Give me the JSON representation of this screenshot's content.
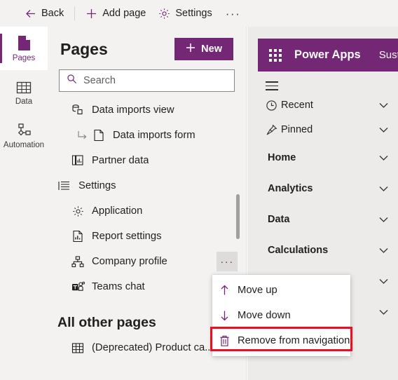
{
  "commandbar": {
    "back_label": "Back",
    "add_page_label": "Add page",
    "settings_label": "Settings",
    "overflow_label": "···"
  },
  "rail": {
    "items": [
      {
        "label": "Pages",
        "icon": "page-icon",
        "active": true
      },
      {
        "label": "Data",
        "icon": "table-icon",
        "active": false
      },
      {
        "label": "Automation",
        "icon": "automation-icon",
        "active": false
      }
    ]
  },
  "pages_panel": {
    "title": "Pages",
    "new_button": "New",
    "search_placeholder": "Search",
    "search_value": "",
    "tree": [
      {
        "label": "Data imports view",
        "icon": "view-icon",
        "indent": 1,
        "type": "item"
      },
      {
        "label": "Data imports form",
        "icon": "form-page-icon",
        "indent": 2,
        "type": "subitem"
      },
      {
        "label": "Partner data",
        "icon": "dashboard-icon",
        "indent": 1,
        "type": "item"
      },
      {
        "label": "Settings",
        "icon": "group-list-icon",
        "indent": 0,
        "type": "group"
      },
      {
        "label": "Application",
        "icon": "gear-icon",
        "indent": 1,
        "type": "item"
      },
      {
        "label": "Report settings",
        "icon": "report-icon",
        "indent": 1,
        "type": "item"
      },
      {
        "label": "Company profile",
        "icon": "sitemap-icon",
        "indent": 1,
        "type": "item",
        "more": "···"
      },
      {
        "label": "Teams chat",
        "icon": "teams-icon",
        "indent": 1,
        "type": "item"
      }
    ],
    "other_section_title": "All other pages",
    "other_items": [
      {
        "label": "(Deprecated) Product ca...",
        "icon": "table-icon",
        "indent": 1,
        "type": "item"
      }
    ]
  },
  "context_menu": {
    "items": [
      {
        "label": "Move up",
        "icon": "arrow-up-icon",
        "highlighted": false
      },
      {
        "label": "Move down",
        "icon": "arrow-down-icon",
        "highlighted": false
      },
      {
        "label": "Remove from navigation",
        "icon": "trash-icon",
        "highlighted": true
      }
    ]
  },
  "preview": {
    "app_title": "Power Apps",
    "app_subtitle": "Susta",
    "nav": [
      {
        "label": "Recent",
        "icon": "clock-icon",
        "group": false,
        "chevron": true
      },
      {
        "label": "Pinned",
        "icon": "pin-icon",
        "group": false,
        "chevron": true
      },
      {
        "label": "Home",
        "icon": "",
        "group": true,
        "chevron": true
      },
      {
        "label": "Analytics",
        "icon": "",
        "group": true,
        "chevron": true
      },
      {
        "label": "Data",
        "icon": "",
        "group": true,
        "chevron": true
      },
      {
        "label": "Calculations",
        "icon": "",
        "group": true,
        "chevron": true
      },
      {
        "label": "",
        "icon": "",
        "group": true,
        "chevron": true
      },
      {
        "label": "",
        "icon": "",
        "group": true,
        "chevron": true
      }
    ]
  },
  "colors": {
    "brand_purple": "#742774",
    "highlight_red": "#e81123",
    "panel_bg": "#f3f2f1",
    "preview_bg": "#edebe9"
  }
}
